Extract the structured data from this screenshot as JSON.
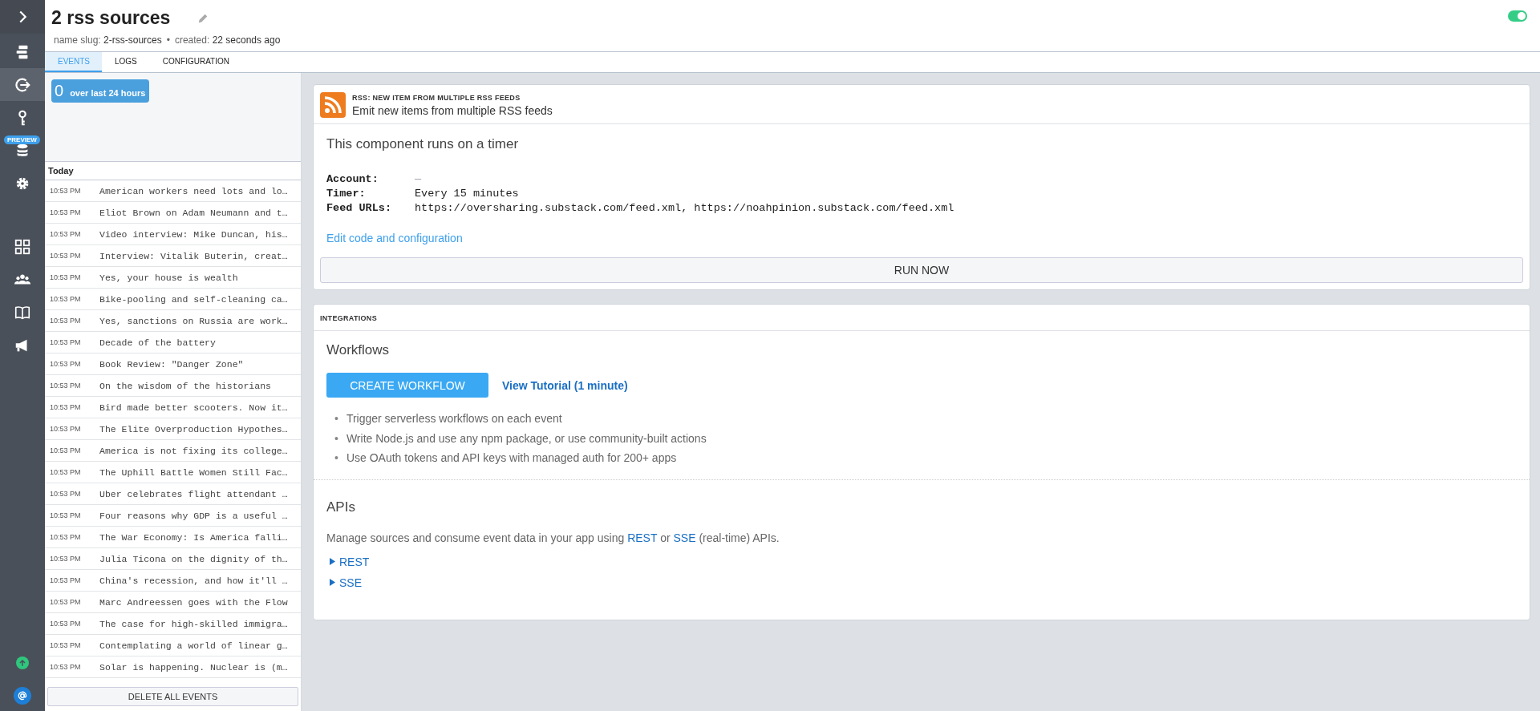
{
  "sidebar": {
    "items": [
      {
        "kind": "chevron",
        "selected": false
      },
      {
        "kind": "sources",
        "selected": false
      },
      {
        "kind": "exit",
        "selected": true
      },
      {
        "kind": "key",
        "selected": false
      },
      {
        "kind": "database",
        "selected": false,
        "badge": "PREVIEW"
      },
      {
        "kind": "gear",
        "selected": false
      },
      {
        "kind": "grid",
        "selected": false
      },
      {
        "kind": "people",
        "selected": false
      },
      {
        "kind": "book",
        "selected": false
      },
      {
        "kind": "megaphone",
        "selected": false
      }
    ],
    "bottom": [
      {
        "kind": "upgrade"
      },
      {
        "kind": "at"
      }
    ]
  },
  "header": {
    "title": "2 rss sources",
    "slug_label": "name slug:",
    "slug": "2-rss-sources",
    "separator": "•",
    "created_label": "created:",
    "created": "22 seconds ago",
    "active": true
  },
  "tabs": [
    {
      "label": "EVENTS",
      "selected": true
    },
    {
      "label": "LOGS",
      "selected": false
    },
    {
      "label": "CONFIGURATION",
      "selected": false
    }
  ],
  "events": {
    "count": "0",
    "count_label": "over last 24 hours",
    "group": "Today",
    "rows": [
      {
        "time": "10:53 PM",
        "title": "American workers need lots and lo…"
      },
      {
        "time": "10:53 PM",
        "title": "Eliot Brown on Adam Neumann and t…"
      },
      {
        "time": "10:53 PM",
        "title": "Video interview: Mike Duncan, his…"
      },
      {
        "time": "10:53 PM",
        "title": "Interview: Vitalik Buterin, creat…"
      },
      {
        "time": "10:53 PM",
        "title": "Yes, your house is wealth"
      },
      {
        "time": "10:53 PM",
        "title": "Bike-pooling and self-cleaning ca…"
      },
      {
        "time": "10:53 PM",
        "title": "Yes, sanctions on Russia are work…"
      },
      {
        "time": "10:53 PM",
        "title": "Decade of the battery"
      },
      {
        "time": "10:53 PM",
        "title": "Book Review: \"Danger Zone\""
      },
      {
        "time": "10:53 PM",
        "title": "On the wisdom of the historians"
      },
      {
        "time": "10:53 PM",
        "title": "Bird made better scooters. Now it…"
      },
      {
        "time": "10:53 PM",
        "title": "The Elite Overproduction Hypothes…"
      },
      {
        "time": "10:53 PM",
        "title": "America is not fixing its college…"
      },
      {
        "time": "10:53 PM",
        "title": "The Uphill Battle Women Still Fac…"
      },
      {
        "time": "10:53 PM",
        "title": "Uber celebrates flight attendant …"
      },
      {
        "time": "10:53 PM",
        "title": "Four reasons why GDP is a useful …"
      },
      {
        "time": "10:53 PM",
        "title": "The War Economy: Is America falli…"
      },
      {
        "time": "10:53 PM",
        "title": "Julia Ticona on the dignity of th…"
      },
      {
        "time": "10:53 PM",
        "title": "China's recession, and how it'll …"
      },
      {
        "time": "10:53 PM",
        "title": "Marc Andreessen goes with the Flow"
      },
      {
        "time": "10:53 PM",
        "title": "The case for high-skilled immigra…"
      },
      {
        "time": "10:53 PM",
        "title": "Contemplating a world of linear g…"
      },
      {
        "time": "10:53 PM",
        "title": "Solar is happening. Nuclear is (m…"
      }
    ],
    "delete_button": "DELETE ALL EVENTS"
  },
  "component": {
    "app": "RSS:",
    "name": "NEW ITEM FROM MULTIPLE RSS FEEDS",
    "description": "Emit new items from multiple RSS feeds",
    "heading": "This component runs on a timer",
    "props": [
      {
        "label": "Account:",
        "value": "—",
        "kind": "empty"
      },
      {
        "label": "Timer:",
        "value": "Every 15 minutes",
        "kind": "text"
      },
      {
        "label": "Feed URLs:",
        "value": "https://oversharing.substack.com/feed.xml, https://noahpinion.substack.com/feed.xml",
        "kind": "text"
      }
    ],
    "edit_link": "Edit code and configuration",
    "run_button": "RUN NOW"
  },
  "integrations": {
    "title": "INTEGRATIONS",
    "workflows": {
      "heading": "Workflows",
      "create_button": "CREATE WORKFLOW",
      "tutorial_link": "View Tutorial (1 minute)",
      "bullets": [
        {
          "marker": "•",
          "text": "Trigger serverless workflows on each event"
        },
        {
          "marker": "•",
          "text": "Write Node.js and use any npm package, or use community-built actions"
        },
        {
          "marker": "•",
          "text": "Use OAuth tokens and API keys with managed auth for 200+ apps"
        }
      ]
    },
    "apis": {
      "heading": "APIs",
      "text_before": "Manage sources and consume event data in your app using",
      "link_1": "REST",
      "text_middle": "or",
      "link_2": "SSE",
      "text_after": "(real-time) APIs.",
      "sections": [
        {
          "label": "REST",
          "expanded": false
        },
        {
          "label": "SSE",
          "expanded": false
        }
      ]
    }
  }
}
